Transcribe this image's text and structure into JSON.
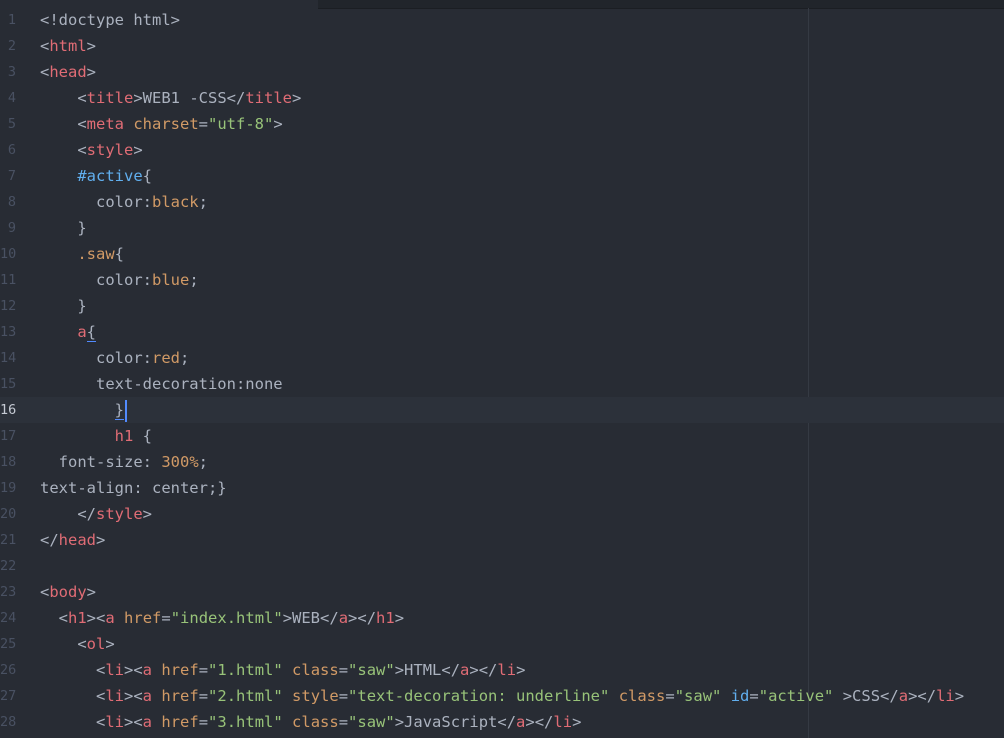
{
  "editor": {
    "file_language": "HTML",
    "cursor_line": 16,
    "theme_colors": {
      "background": "#282c34",
      "tag": "#e06c75",
      "attribute": "#d19a66",
      "string": "#98c379",
      "id_selector": "#61afef",
      "text": "#abb2bf",
      "caret": "#528bff"
    }
  },
  "lines": [
    {
      "n": "1",
      "t": [
        [
          "p",
          "<!doctype html>"
        ]
      ]
    },
    {
      "n": "2",
      "t": [
        [
          "p",
          "<"
        ],
        [
          "tag",
          "html"
        ],
        [
          "p",
          ">"
        ]
      ]
    },
    {
      "n": "3",
      "t": [
        [
          "p",
          "<"
        ],
        [
          "tag",
          "head"
        ],
        [
          "p",
          ">"
        ]
      ]
    },
    {
      "n": "4",
      "t": [
        [
          "p",
          "    <"
        ],
        [
          "tag",
          "title"
        ],
        [
          "p",
          ">WEB1 -CSS</"
        ],
        [
          "tag",
          "title"
        ],
        [
          "p",
          ">"
        ]
      ]
    },
    {
      "n": "5",
      "t": [
        [
          "p",
          "    <"
        ],
        [
          "tag",
          "meta"
        ],
        [
          "p",
          " "
        ],
        [
          "attr",
          "charset"
        ],
        [
          "p",
          "="
        ],
        [
          "str",
          "\"utf-8\""
        ],
        [
          "p",
          ">"
        ]
      ]
    },
    {
      "n": "6",
      "t": [
        [
          "p",
          "    <"
        ],
        [
          "tag",
          "style"
        ],
        [
          "p",
          ">"
        ]
      ]
    },
    {
      "n": "7",
      "t": [
        [
          "p",
          "    "
        ],
        [
          "id",
          "#active"
        ],
        [
          "p",
          "{"
        ]
      ]
    },
    {
      "n": "8",
      "t": [
        [
          "p",
          "      color:"
        ],
        [
          "val",
          "black"
        ],
        [
          "p",
          ";"
        ]
      ]
    },
    {
      "n": "9",
      "t": [
        [
          "p",
          "    }"
        ]
      ]
    },
    {
      "n": "10",
      "t": [
        [
          "p",
          "    "
        ],
        [
          "cls",
          ".saw"
        ],
        [
          "p",
          "{"
        ]
      ]
    },
    {
      "n": "11",
      "t": [
        [
          "p",
          "      color:"
        ],
        [
          "val",
          "blue"
        ],
        [
          "p",
          ";"
        ]
      ]
    },
    {
      "n": "12",
      "t": [
        [
          "p",
          "    }"
        ]
      ]
    },
    {
      "n": "13",
      "t": [
        [
          "p",
          "    "
        ],
        [
          "tag",
          "a"
        ],
        [
          "bm",
          "{"
        ]
      ]
    },
    {
      "n": "14",
      "t": [
        [
          "p",
          "      color:"
        ],
        [
          "val",
          "red"
        ],
        [
          "p",
          ";"
        ]
      ]
    },
    {
      "n": "15",
      "t": [
        [
          "p",
          "      text-decoration:none"
        ]
      ]
    },
    {
      "n": "16",
      "t": [
        [
          "p",
          "        "
        ],
        [
          "bm",
          "}"
        ],
        [
          "caret",
          ""
        ]
      ]
    },
    {
      "n": "17",
      "t": [
        [
          "p",
          "        "
        ],
        [
          "tag",
          "h1"
        ],
        [
          "p",
          " {"
        ]
      ]
    },
    {
      "n": "18",
      "t": [
        [
          "p",
          "  font-size: "
        ],
        [
          "val",
          "300%"
        ],
        [
          "p",
          ";"
        ]
      ]
    },
    {
      "n": "19",
      "t": [
        [
          "p",
          "text-align: center;}"
        ]
      ]
    },
    {
      "n": "20",
      "t": [
        [
          "p",
          "    </"
        ],
        [
          "tag",
          "style"
        ],
        [
          "p",
          ">"
        ]
      ]
    },
    {
      "n": "21",
      "t": [
        [
          "p",
          "</"
        ],
        [
          "tag",
          "head"
        ],
        [
          "p",
          ">"
        ]
      ]
    },
    {
      "n": "22",
      "t": [
        [
          "p",
          ""
        ]
      ]
    },
    {
      "n": "23",
      "t": [
        [
          "p",
          "<"
        ],
        [
          "tag",
          "body"
        ],
        [
          "p",
          ">"
        ]
      ]
    },
    {
      "n": "24",
      "t": [
        [
          "p",
          "  <"
        ],
        [
          "tag",
          "h1"
        ],
        [
          "p",
          "><"
        ],
        [
          "tag",
          "a"
        ],
        [
          "p",
          " "
        ],
        [
          "attr",
          "href"
        ],
        [
          "p",
          "="
        ],
        [
          "str",
          "\"index.html\""
        ],
        [
          "p",
          ">WEB</"
        ],
        [
          "tag",
          "a"
        ],
        [
          "p",
          "></"
        ],
        [
          "tag",
          "h1"
        ],
        [
          "p",
          ">"
        ]
      ]
    },
    {
      "n": "25",
      "t": [
        [
          "p",
          "    <"
        ],
        [
          "tag",
          "ol"
        ],
        [
          "p",
          ">"
        ]
      ]
    },
    {
      "n": "26",
      "t": [
        [
          "p",
          "      <"
        ],
        [
          "tag",
          "li"
        ],
        [
          "p",
          "><"
        ],
        [
          "tag",
          "a"
        ],
        [
          "p",
          " "
        ],
        [
          "attr",
          "href"
        ],
        [
          "p",
          "="
        ],
        [
          "str",
          "\"1.html\""
        ],
        [
          "p",
          " "
        ],
        [
          "attr",
          "class"
        ],
        [
          "p",
          "="
        ],
        [
          "str",
          "\"saw\""
        ],
        [
          "p",
          ">HTML</"
        ],
        [
          "tag",
          "a"
        ],
        [
          "p",
          "></"
        ],
        [
          "tag",
          "li"
        ],
        [
          "p",
          ">"
        ]
      ]
    },
    {
      "n": "27",
      "t": [
        [
          "p",
          "      <"
        ],
        [
          "tag",
          "li"
        ],
        [
          "p",
          "><"
        ],
        [
          "tag",
          "a"
        ],
        [
          "p",
          " "
        ],
        [
          "attr",
          "href"
        ],
        [
          "p",
          "="
        ],
        [
          "str",
          "\"2.html\""
        ],
        [
          "p",
          " "
        ],
        [
          "attr",
          "style"
        ],
        [
          "p",
          "="
        ],
        [
          "str",
          "\"text-decoration: underline\""
        ],
        [
          "p",
          " "
        ],
        [
          "attr",
          "class"
        ],
        [
          "p",
          "="
        ],
        [
          "str",
          "\"saw\""
        ],
        [
          "p",
          " "
        ],
        [
          "id",
          "id"
        ],
        [
          "p",
          "="
        ],
        [
          "str",
          "\"active\""
        ],
        [
          "p",
          " >CSS</"
        ],
        [
          "tag",
          "a"
        ],
        [
          "p",
          "></"
        ],
        [
          "tag",
          "li"
        ],
        [
          "p",
          ">"
        ]
      ]
    },
    {
      "n": "28",
      "t": [
        [
          "p",
          "      <"
        ],
        [
          "tag",
          "li"
        ],
        [
          "p",
          "><"
        ],
        [
          "tag",
          "a"
        ],
        [
          "p",
          " "
        ],
        [
          "attr",
          "href"
        ],
        [
          "p",
          "="
        ],
        [
          "str",
          "\"3.html\""
        ],
        [
          "p",
          " "
        ],
        [
          "attr",
          "class"
        ],
        [
          "p",
          "="
        ],
        [
          "str",
          "\"saw\""
        ],
        [
          "p",
          ">JavaScript</"
        ],
        [
          "tag",
          "a"
        ],
        [
          "p",
          "></"
        ],
        [
          "tag",
          "li"
        ],
        [
          "p",
          ">"
        ]
      ]
    }
  ]
}
